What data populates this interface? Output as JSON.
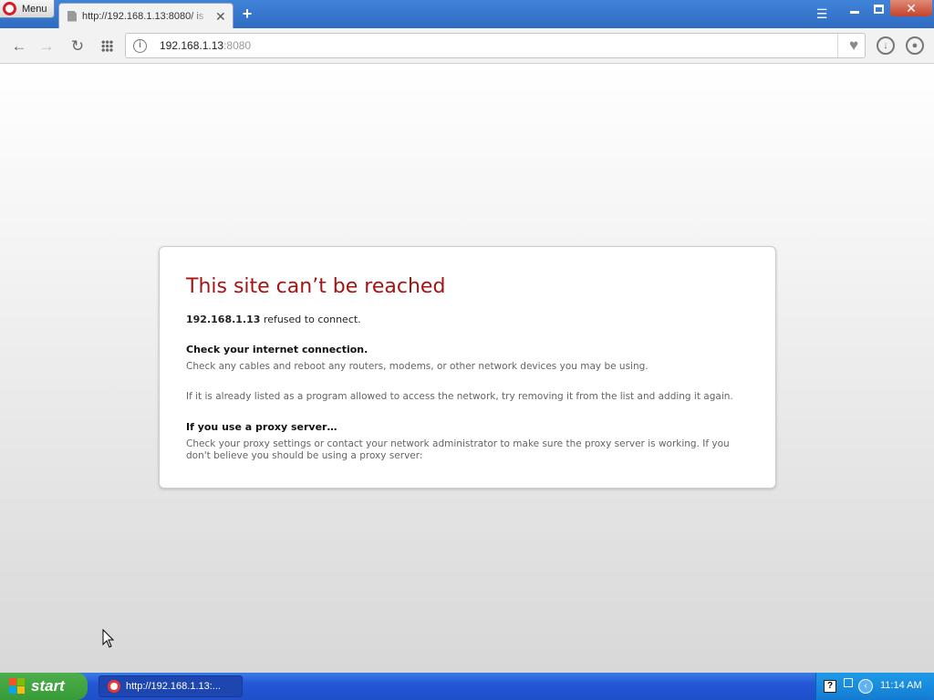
{
  "browser": {
    "menu_label": "Menu",
    "tab": {
      "title": "http://192.168.1.13:8080/ is"
    },
    "new_tab_icon": "plus-icon",
    "address": {
      "host": "192.168.1.13",
      "port": ":8080"
    }
  },
  "error_page": {
    "title": "This site can’t be reached",
    "host": "192.168.1.13",
    "refused_text": " refused to connect.",
    "section1_heading": "Check your internet connection.",
    "section1_text": "Check any cables and reboot any routers, modems, or other network devices you may be using.",
    "section1_text2": "If it is already listed as a program allowed to access the network, try removing it from the list and adding it again.",
    "section2_heading": "If you use a proxy server…",
    "section2_text": "Check your proxy settings or contact your network administrator to make sure the proxy server is working. If you don't believe you should be using a proxy server:"
  },
  "taskbar": {
    "start_label": "start",
    "task_label": "http://192.168.1.13:...",
    "clock": "11:14 AM"
  },
  "colors": {
    "error_title": "#a61313",
    "titlebar": "#3f83d8",
    "taskbar": "#2457d6",
    "start_button": "#4cae4c"
  }
}
